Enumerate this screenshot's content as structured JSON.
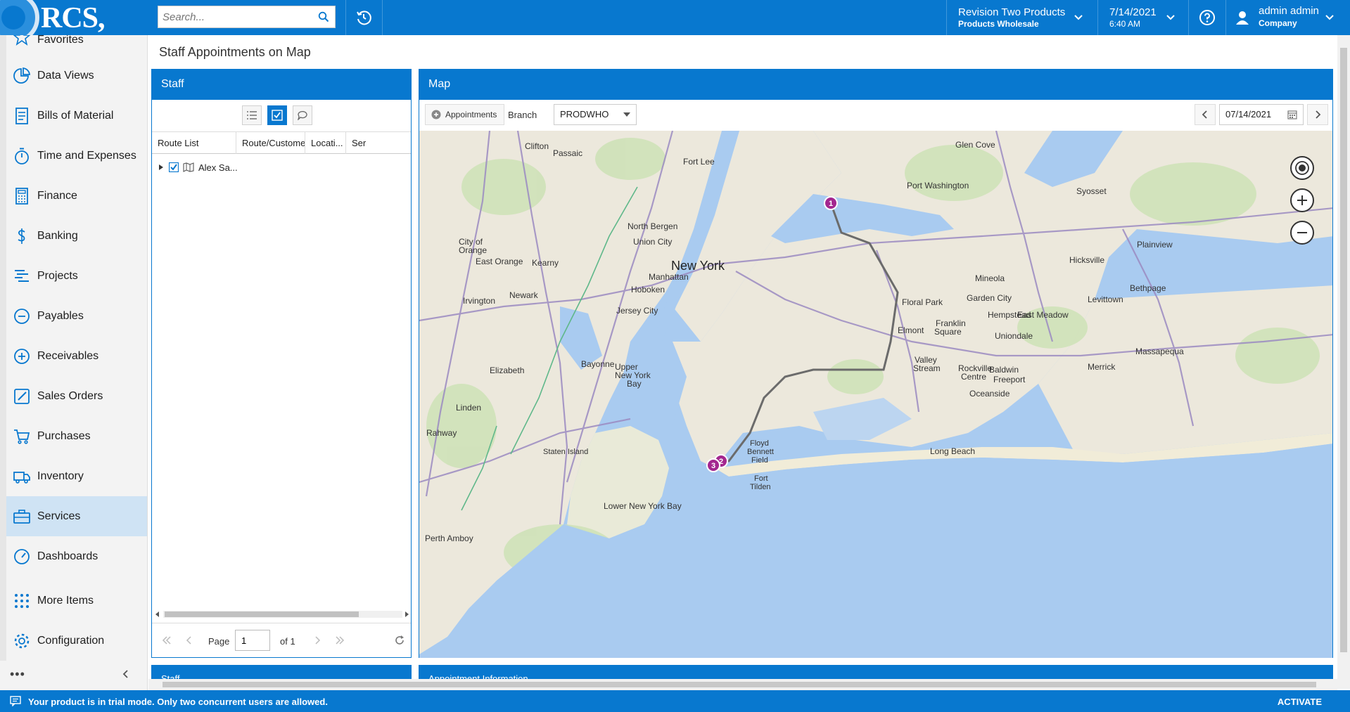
{
  "header": {
    "logo": "RCS, inc.",
    "search_placeholder": "Search...",
    "company_line1": "Revision Two Products",
    "company_line2": "Products Wholesale",
    "date_line1": "7/14/2021",
    "date_line2": "6:40 AM",
    "user_line1": "admin admin",
    "user_line2": "Company"
  },
  "sidebar": {
    "partial_item": "Favorites",
    "items": [
      {
        "label": "Data Views",
        "icon": "pie-chart-icon"
      },
      {
        "label": "Bills of Material",
        "icon": "document-icon"
      },
      {
        "label": "Time and Expenses",
        "icon": "stopwatch-icon"
      },
      {
        "label": "Finance",
        "icon": "calculator-icon"
      },
      {
        "label": "Banking",
        "icon": "dollar-icon"
      },
      {
        "label": "Projects",
        "icon": "projects-icon"
      },
      {
        "label": "Payables",
        "icon": "minus-circle-icon"
      },
      {
        "label": "Receivables",
        "icon": "plus-circle-icon"
      },
      {
        "label": "Sales Orders",
        "icon": "pencil-icon"
      },
      {
        "label": "Purchases",
        "icon": "cart-icon"
      },
      {
        "label": "Inventory",
        "icon": "truck-icon"
      },
      {
        "label": "Services",
        "icon": "briefcase-icon"
      },
      {
        "label": "Dashboards",
        "icon": "gauge-icon"
      },
      {
        "label": "More Items",
        "icon": "grid-icon"
      },
      {
        "label": "Configuration",
        "icon": "gear-icon"
      }
    ],
    "active": "Services",
    "more": "•••"
  },
  "page": {
    "title": "Staff Appointments on Map"
  },
  "staff_panel": {
    "title": "Staff",
    "columns": [
      "Route List",
      "Route/Customer",
      "Locati...",
      "Ser"
    ],
    "row_label": "Alex Sa...",
    "pager": {
      "page_label": "Page",
      "page_value": "1",
      "of_label": "of 1"
    }
  },
  "map_panel": {
    "title": "Map",
    "appointments_button": "Appointments",
    "branch_label": "Branch",
    "branch_value": "PRODWHO",
    "date_value": "07/14/2021"
  },
  "map": {
    "labels": {
      "new_york": "New York",
      "upper_bay": "Upper",
      "upper_bay2": "New York",
      "upper_bay3": "Bay",
      "lower_bay": "Lower New York Bay",
      "newark": "Newark",
      "jersey_city": "Jersey City",
      "hoboken": "Hoboken",
      "manhattan": "Manhattan",
      "elizabeth": "Elizabeth",
      "bayonne": "Bayonne",
      "linden": "Linden",
      "rahway": "Rahway",
      "perth_amboy": "Perth Amboy",
      "glen_cove": "Glen Cove",
      "port_washington": "Port Washington",
      "syosset": "Syosset",
      "plainview": "Plainview",
      "hicksville": "Hicksville",
      "mineola": "Mineola",
      "garden_city": "Garden City",
      "floral_park": "Floral Park",
      "hempstead": "Hempstead",
      "long_beach": "Long Beach",
      "fort_lee": "Fort Lee",
      "north_bergen": "North Bergen",
      "union_city": "Union City",
      "clifton": "Clifton",
      "passaic": "Passaic",
      "kearny": "Kearny",
      "irvington": "Irvington",
      "east_orange": "East Orange",
      "city_of_orange": "City of",
      "city_of_orange2": "Orange",
      "staten_island": "Staten Island",
      "valley_stream": "Valley",
      "valley_stream2": "Stream",
      "oceanside": "Oceanside",
      "freeport": "Freeport",
      "baldwin": "Baldwin",
      "levittown": "Levittown",
      "bethpage": "Bethpage",
      "massapequa": "Massapequa",
      "merrick": "Merrick",
      "elmont": "Elmont",
      "franklin_square": "Franklin",
      "franklin_square2": "Square",
      "east_meadow": "East Meadow",
      "uniondale": "Uniondale",
      "rockville_centre": "Rockville",
      "rockville_centre2": "Centre",
      "floyd_bennett": "Floyd",
      "floyd_bennett2": "Bennett",
      "floyd_bennett3": "Field",
      "fort_tilden": "Fort",
      "fort_tilden2": "Tilden"
    },
    "markers": [
      "1",
      "2",
      "3"
    ]
  },
  "bottom": {
    "staff_title": "Staff",
    "appt_title": "Appointment Information"
  },
  "trial": {
    "message": "Your product is in trial mode. Only two concurrent users are allowed.",
    "activate": "ACTIVATE"
  },
  "colors": {
    "brand": "#0878cf",
    "active_nav": "#cfe3f4",
    "water": "#a9cbf0",
    "land": "#ece8dc",
    "marker": "#a3268f",
    "route": "#6b6b6b"
  }
}
